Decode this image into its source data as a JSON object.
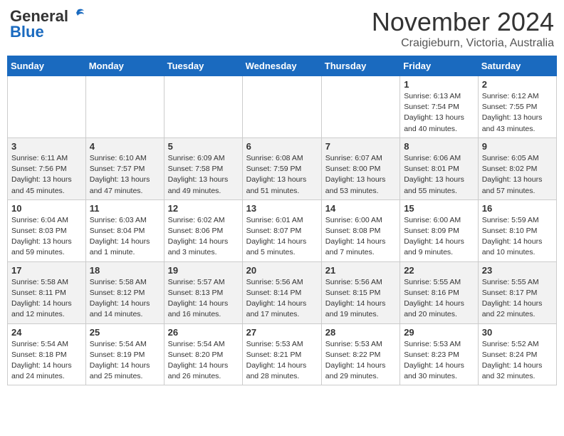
{
  "header": {
    "logo_general": "General",
    "logo_blue": "Blue",
    "month_title": "November 2024",
    "location": "Craigieburn, Victoria, Australia"
  },
  "weekdays": [
    "Sunday",
    "Monday",
    "Tuesday",
    "Wednesday",
    "Thursday",
    "Friday",
    "Saturday"
  ],
  "weeks": [
    [
      {
        "day": "",
        "info": ""
      },
      {
        "day": "",
        "info": ""
      },
      {
        "day": "",
        "info": ""
      },
      {
        "day": "",
        "info": ""
      },
      {
        "day": "",
        "info": ""
      },
      {
        "day": "1",
        "info": "Sunrise: 6:13 AM\nSunset: 7:54 PM\nDaylight: 13 hours\nand 40 minutes."
      },
      {
        "day": "2",
        "info": "Sunrise: 6:12 AM\nSunset: 7:55 PM\nDaylight: 13 hours\nand 43 minutes."
      }
    ],
    [
      {
        "day": "3",
        "info": "Sunrise: 6:11 AM\nSunset: 7:56 PM\nDaylight: 13 hours\nand 45 minutes."
      },
      {
        "day": "4",
        "info": "Sunrise: 6:10 AM\nSunset: 7:57 PM\nDaylight: 13 hours\nand 47 minutes."
      },
      {
        "day": "5",
        "info": "Sunrise: 6:09 AM\nSunset: 7:58 PM\nDaylight: 13 hours\nand 49 minutes."
      },
      {
        "day": "6",
        "info": "Sunrise: 6:08 AM\nSunset: 7:59 PM\nDaylight: 13 hours\nand 51 minutes."
      },
      {
        "day": "7",
        "info": "Sunrise: 6:07 AM\nSunset: 8:00 PM\nDaylight: 13 hours\nand 53 minutes."
      },
      {
        "day": "8",
        "info": "Sunrise: 6:06 AM\nSunset: 8:01 PM\nDaylight: 13 hours\nand 55 minutes."
      },
      {
        "day": "9",
        "info": "Sunrise: 6:05 AM\nSunset: 8:02 PM\nDaylight: 13 hours\nand 57 minutes."
      }
    ],
    [
      {
        "day": "10",
        "info": "Sunrise: 6:04 AM\nSunset: 8:03 PM\nDaylight: 13 hours\nand 59 minutes."
      },
      {
        "day": "11",
        "info": "Sunrise: 6:03 AM\nSunset: 8:04 PM\nDaylight: 14 hours\nand 1 minute."
      },
      {
        "day": "12",
        "info": "Sunrise: 6:02 AM\nSunset: 8:06 PM\nDaylight: 14 hours\nand 3 minutes."
      },
      {
        "day": "13",
        "info": "Sunrise: 6:01 AM\nSunset: 8:07 PM\nDaylight: 14 hours\nand 5 minutes."
      },
      {
        "day": "14",
        "info": "Sunrise: 6:00 AM\nSunset: 8:08 PM\nDaylight: 14 hours\nand 7 minutes."
      },
      {
        "day": "15",
        "info": "Sunrise: 6:00 AM\nSunset: 8:09 PM\nDaylight: 14 hours\nand 9 minutes."
      },
      {
        "day": "16",
        "info": "Sunrise: 5:59 AM\nSunset: 8:10 PM\nDaylight: 14 hours\nand 10 minutes."
      }
    ],
    [
      {
        "day": "17",
        "info": "Sunrise: 5:58 AM\nSunset: 8:11 PM\nDaylight: 14 hours\nand 12 minutes."
      },
      {
        "day": "18",
        "info": "Sunrise: 5:58 AM\nSunset: 8:12 PM\nDaylight: 14 hours\nand 14 minutes."
      },
      {
        "day": "19",
        "info": "Sunrise: 5:57 AM\nSunset: 8:13 PM\nDaylight: 14 hours\nand 16 minutes."
      },
      {
        "day": "20",
        "info": "Sunrise: 5:56 AM\nSunset: 8:14 PM\nDaylight: 14 hours\nand 17 minutes."
      },
      {
        "day": "21",
        "info": "Sunrise: 5:56 AM\nSunset: 8:15 PM\nDaylight: 14 hours\nand 19 minutes."
      },
      {
        "day": "22",
        "info": "Sunrise: 5:55 AM\nSunset: 8:16 PM\nDaylight: 14 hours\nand 20 minutes."
      },
      {
        "day": "23",
        "info": "Sunrise: 5:55 AM\nSunset: 8:17 PM\nDaylight: 14 hours\nand 22 minutes."
      }
    ],
    [
      {
        "day": "24",
        "info": "Sunrise: 5:54 AM\nSunset: 8:18 PM\nDaylight: 14 hours\nand 24 minutes."
      },
      {
        "day": "25",
        "info": "Sunrise: 5:54 AM\nSunset: 8:19 PM\nDaylight: 14 hours\nand 25 minutes."
      },
      {
        "day": "26",
        "info": "Sunrise: 5:54 AM\nSunset: 8:20 PM\nDaylight: 14 hours\nand 26 minutes."
      },
      {
        "day": "27",
        "info": "Sunrise: 5:53 AM\nSunset: 8:21 PM\nDaylight: 14 hours\nand 28 minutes."
      },
      {
        "day": "28",
        "info": "Sunrise: 5:53 AM\nSunset: 8:22 PM\nDaylight: 14 hours\nand 29 minutes."
      },
      {
        "day": "29",
        "info": "Sunrise: 5:53 AM\nSunset: 8:23 PM\nDaylight: 14 hours\nand 30 minutes."
      },
      {
        "day": "30",
        "info": "Sunrise: 5:52 AM\nSunset: 8:24 PM\nDaylight: 14 hours\nand 32 minutes."
      }
    ]
  ]
}
